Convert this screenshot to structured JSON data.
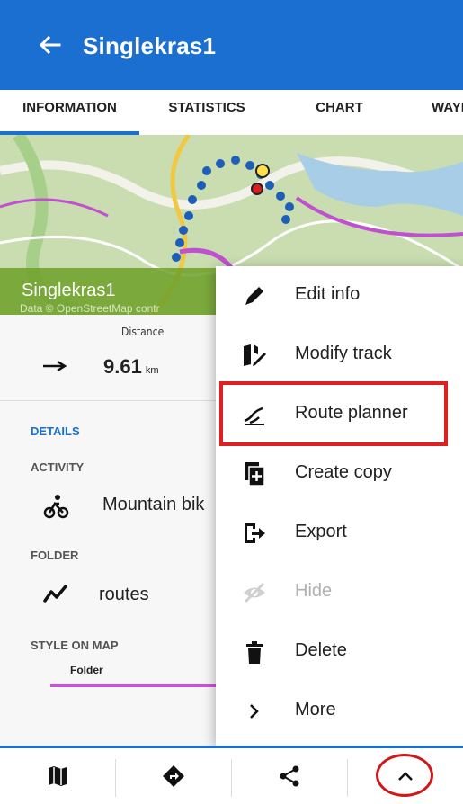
{
  "header": {
    "title": "Singlekras1"
  },
  "tabs": [
    {
      "label": "INFORMATION"
    },
    {
      "label": "STATISTICS"
    },
    {
      "label": "CHART"
    },
    {
      "label": "WAYP"
    }
  ],
  "map": {
    "track_name": "Singlekras1",
    "attribution": "Data © OpenStreetMap contr"
  },
  "stats": {
    "distance_label": "Distance",
    "distance_value": "9.61",
    "distance_unit": "km"
  },
  "details": {
    "section": "DETAILS",
    "activity_label": "ACTIVITY",
    "activity_value": "Mountain bik",
    "folder_label": "FOLDER",
    "folder_value": "routes",
    "style_label": "STYLE ON MAP",
    "style_sub": "Folder",
    "style_color": "#d04fe0"
  },
  "menu": {
    "items": [
      {
        "label": "Edit info",
        "icon": "pencil-icon"
      },
      {
        "label": "Modify track",
        "icon": "modify-track-icon"
      },
      {
        "label": "Route planner",
        "icon": "route-planner-icon"
      },
      {
        "label": "Create copy",
        "icon": "copy-icon"
      },
      {
        "label": "Export",
        "icon": "export-icon"
      },
      {
        "label": "Hide",
        "icon": "hide-icon"
      },
      {
        "label": "Delete",
        "icon": "trash-icon"
      },
      {
        "label": "More",
        "icon": "chevron-right-icon"
      }
    ]
  },
  "bottom_bar": [
    {
      "icon": "map-icon"
    },
    {
      "icon": "navigate-icon"
    },
    {
      "icon": "share-icon"
    },
    {
      "icon": "chevron-up-icon"
    }
  ],
  "colors": {
    "primary": "#1a6fd1",
    "highlight": "#e02020",
    "track": "#1d5fb8"
  }
}
